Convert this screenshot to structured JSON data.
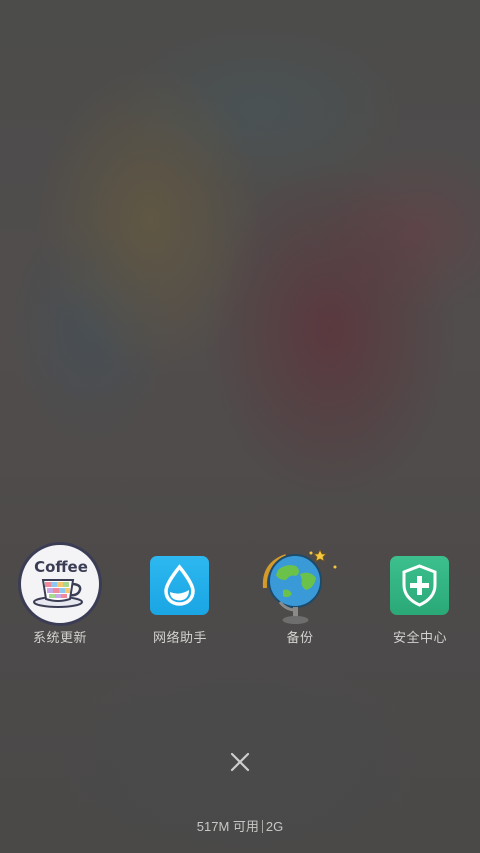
{
  "apps": [
    {
      "label": "系统更新",
      "icon": "coffee-cup-icon",
      "icon_text": "Coffee"
    },
    {
      "label": "网络助手",
      "icon": "water-drop-icon"
    },
    {
      "label": "备份",
      "icon": "globe-icon"
    },
    {
      "label": "安全中心",
      "icon": "shield-plus-icon"
    }
  ],
  "close": {
    "icon": "close-icon"
  },
  "memory": {
    "available": "517M 可用",
    "total": "2G"
  },
  "colors": {
    "label_text": "#d4d2d0",
    "drop_tile": "#1aa5e4",
    "shield_tile": "#2aa977",
    "coffee_border": "#3b3d55"
  }
}
